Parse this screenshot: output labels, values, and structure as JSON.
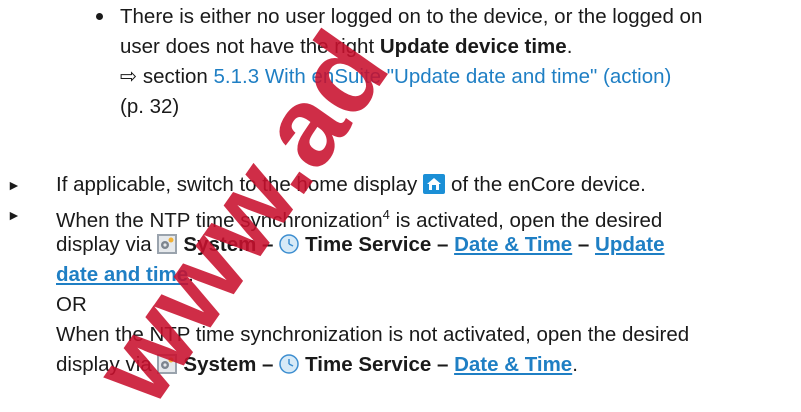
{
  "bullet_item": {
    "line1": "There is either no user logged on to the device, or the logged on",
    "line2_pre": "user does not have the right ",
    "line2_bold": "Update device time",
    "line2_post": ".",
    "ref_arrow": "⇨ section ",
    "ref_link": "5.1.3 With enSuite \"Update date and time\" (action)",
    "ref_page": "(p. 32)"
  },
  "steps": [
    {
      "pre": "If applicable, switch to the home display",
      "post": "of the enCore device.",
      "icon": "home-icon"
    },
    {
      "line1_pre": "When the NTP time synchronization",
      "footnote": "4",
      "line1_post": " is activated, open the desired",
      "line2_pre": "display via",
      "system": "System –",
      "time_service": "Time Service –",
      "date_time": "Date & Time",
      "dash": "–",
      "update_part1": "Update",
      "update_part2": "date and time",
      "period": ".",
      "or": "OR"
    },
    {
      "line1": "When the NTP time synchronization is not activated, open the desired",
      "line2_pre": "display via",
      "system": "System –",
      "time_service": "Time Service –",
      "date_time": "Date & Time",
      "period": "."
    }
  ],
  "colors": {
    "link": "#1f7fc4",
    "watermark": "#c8102e",
    "home_icon": "#1b8fd6"
  },
  "watermark_text": "www.ad"
}
